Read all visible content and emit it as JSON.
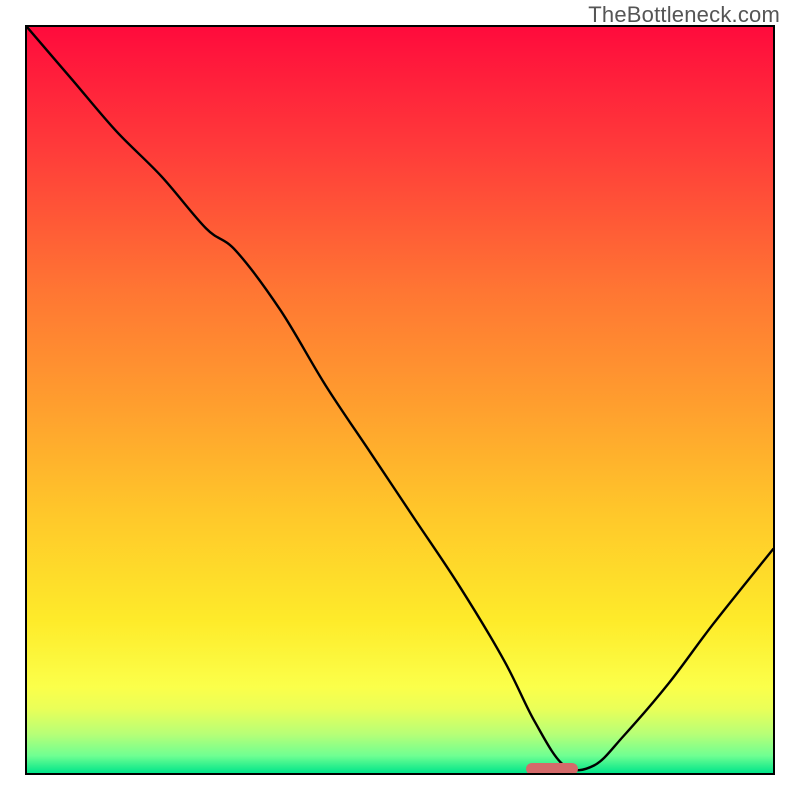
{
  "watermark": "TheBottleneck.com",
  "chart_data": {
    "type": "line",
    "title": "",
    "xlabel": "",
    "ylabel": "",
    "xlim": [
      0,
      100
    ],
    "ylim": [
      0,
      100
    ],
    "grid": false,
    "legend": false,
    "marker": {
      "x_start": 67,
      "x_end": 74,
      "y": 0.5,
      "color": "#d46a6a"
    },
    "series": [
      {
        "name": "bottleneck-curve",
        "x": [
          0,
          6,
          12,
          18,
          24,
          28,
          34,
          40,
          46,
          52,
          58,
          64,
          68,
          72,
          76,
          80,
          86,
          92,
          100
        ],
        "y": [
          100,
          93,
          86,
          80,
          73,
          70,
          62,
          52,
          43,
          34,
          25,
          15,
          7,
          1,
          1,
          5,
          12,
          20,
          30
        ]
      }
    ],
    "background_gradient": {
      "stops": [
        {
          "pos": 0.0,
          "color": "#ff0b3c"
        },
        {
          "pos": 0.2,
          "color": "#ff3a3a"
        },
        {
          "pos": 0.4,
          "color": "#ff7633"
        },
        {
          "pos": 0.58,
          "color": "#ffa02e"
        },
        {
          "pos": 0.74,
          "color": "#ffc82a"
        },
        {
          "pos": 0.88,
          "color": "#fbff4a"
        },
        {
          "pos": 0.94,
          "color": "#b6ff77"
        },
        {
          "pos": 1.0,
          "color": "#00e58a"
        }
      ]
    }
  }
}
